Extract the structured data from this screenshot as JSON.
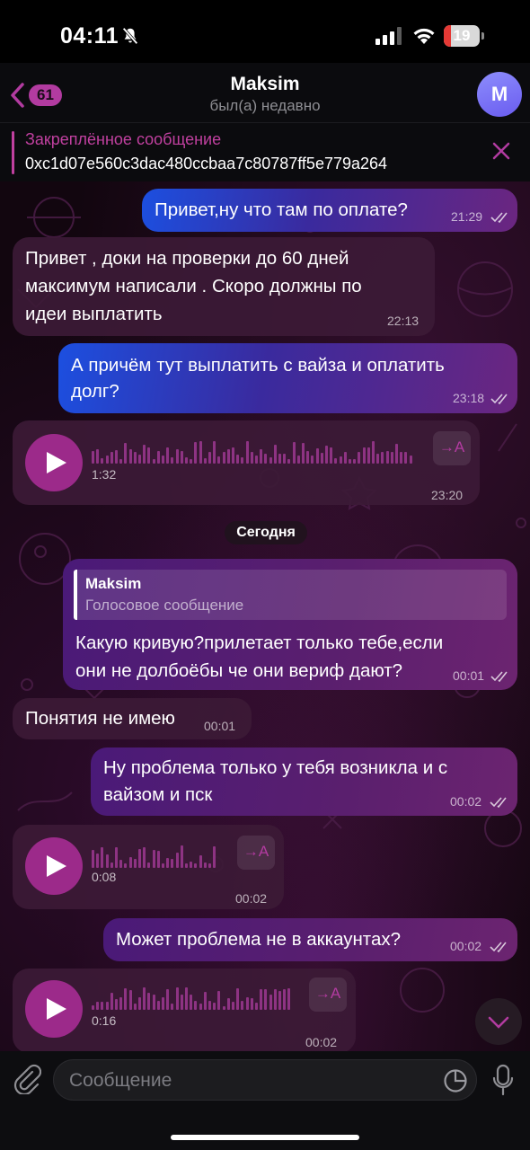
{
  "status_bar": {
    "time": "04:11",
    "battery": "19",
    "battery_level": 0.19
  },
  "header": {
    "back_count": "61",
    "title": "Maksim",
    "subtitle": "был(а) недавно",
    "avatar_letter": "M"
  },
  "pinned": {
    "label": "Закреплённое сообщение",
    "text": "0xc1d07e560c3dac480ccbaa7c80787ff5e779a264"
  },
  "messages": [
    {
      "dir": "out",
      "text": "Привет,ну что там по оплате?",
      "time": "21:29"
    },
    {
      "dir": "in",
      "lines": [
        "Привет , доки на проверки до 60 дней",
        "максимум написали . Скоро должны по",
        "идеи выплатить"
      ],
      "time": "22:13"
    },
    {
      "dir": "out",
      "lines": [
        "А причём тут выплатить с вайза и оплатить",
        "долг?"
      ],
      "time": "23:18"
    },
    {
      "dir": "in",
      "type": "voice",
      "duration": "1:32",
      "time": "23:20",
      "transcribe": "→A"
    },
    {
      "dir": "out",
      "reply": {
        "name": "Maksim",
        "text": "Голосовое сообщение"
      },
      "lines": [
        "Какую кривую?прилетает только тебе,если",
        "они не долбоёбы че они вериф дают?"
      ],
      "time": "00:01"
    },
    {
      "dir": "in",
      "text": "Понятия не имею",
      "time": "00:01"
    },
    {
      "dir": "out",
      "lines": [
        "Ну проблема только у тебя возникла и с",
        "вайзом и пск"
      ],
      "time": "00:02"
    },
    {
      "dir": "in",
      "type": "voice",
      "duration": "0:08",
      "time": "00:02",
      "transcribe": "→A"
    },
    {
      "dir": "out",
      "text": "Может проблема не в аккаунтах?",
      "time": "00:02"
    },
    {
      "dir": "in",
      "type": "voice",
      "duration": "0:16",
      "time": "00:02",
      "transcribe": "→A"
    }
  ],
  "date_separator": "Сегодня",
  "input": {
    "placeholder": "Сообщение"
  },
  "colors": {
    "accent": "#b23ba0",
    "play": "#9c2a8a",
    "outgoing_start": "#1c4fe0",
    "outgoing_end": "#6b2680",
    "incoming": "#3c1a36"
  }
}
